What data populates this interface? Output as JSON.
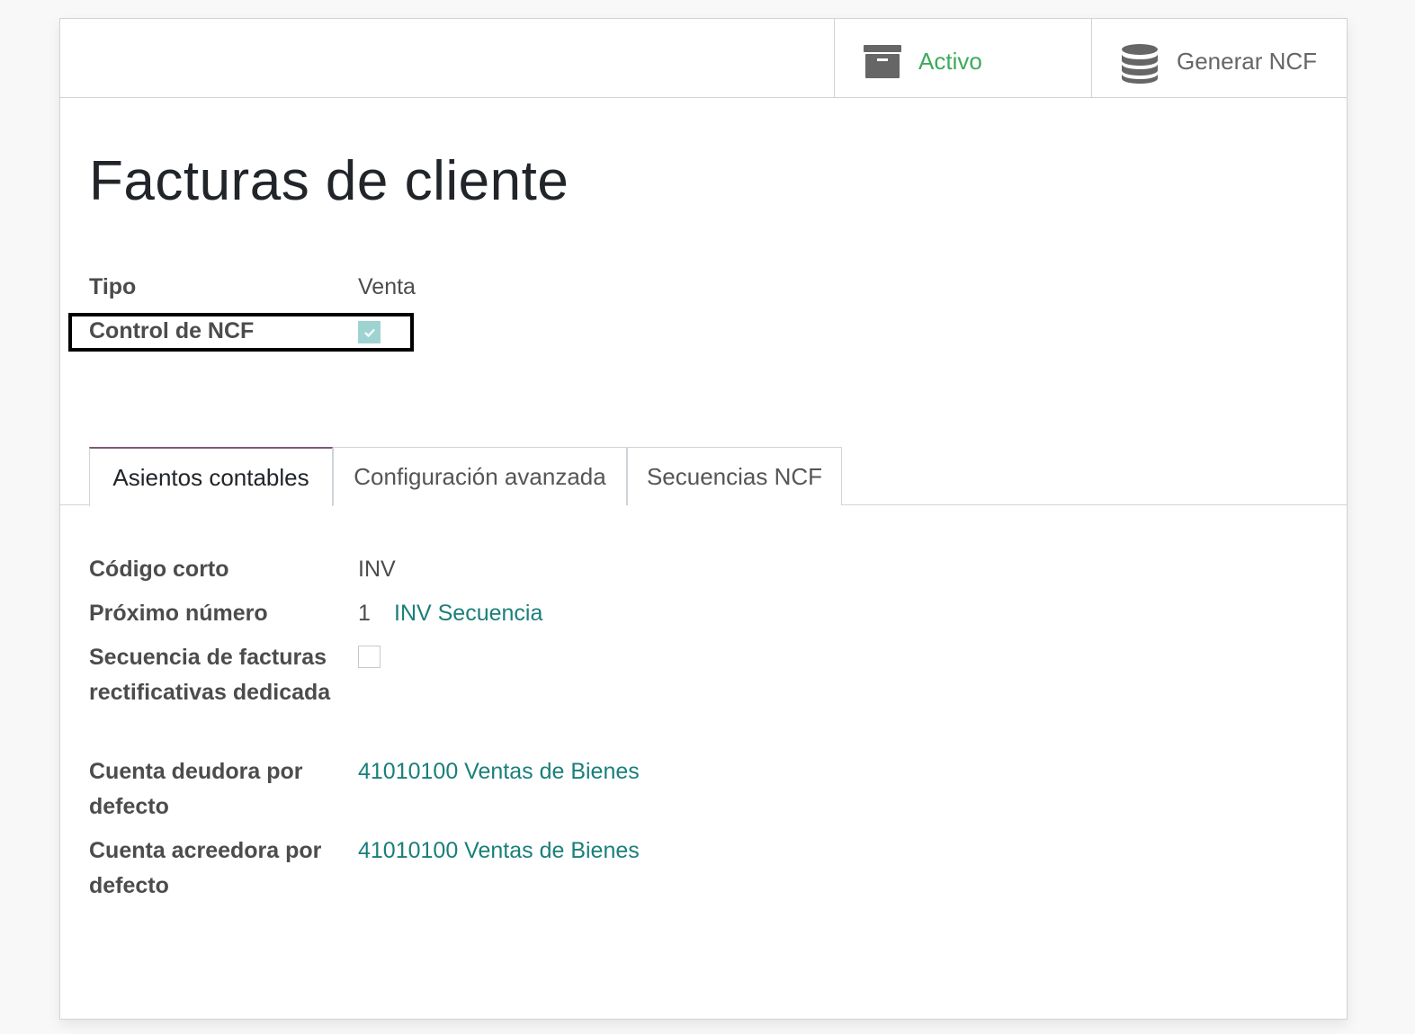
{
  "header": {
    "active_label": "Activo",
    "active_icon": "archive-icon",
    "ncf_label": "Generar NCF",
    "ncf_icon": "database-icon",
    "active_color": "#3daa5c"
  },
  "form": {
    "title": "Facturas de cliente",
    "tipo_label": "Tipo",
    "tipo_value": "Venta",
    "control_ncf_label": "Control de NCF",
    "control_ncf_checked": true
  },
  "tabs": [
    {
      "label": "Asientos contables",
      "active": true
    },
    {
      "label": "Configuración avanzada",
      "active": false
    },
    {
      "label": "Secuencias NCF",
      "active": false
    }
  ],
  "tab_content": {
    "codigo_label": "Código corto",
    "codigo_value": "INV",
    "proximo_label": "Próximo número",
    "proximo_value": "1",
    "proximo_link": "INV Secuencia",
    "secuencia_label_1": "Secuencia de facturas",
    "secuencia_label_2": "rectificativas dedicada",
    "secuencia_checked": false,
    "deudora_label_1": "Cuenta deudora por",
    "deudora_label_2": "defecto",
    "deudora_value": "41010100 Ventas de Bienes",
    "acreedora_label_1": "Cuenta acreedora por",
    "acreedora_label_2": "defecto",
    "acreedora_value": "41010100 Ventas de Bienes"
  },
  "colors": {
    "link": "#1a7f7a",
    "tab_accent": "#7c5a76",
    "checkbox_checked": "#9fd3d2"
  }
}
